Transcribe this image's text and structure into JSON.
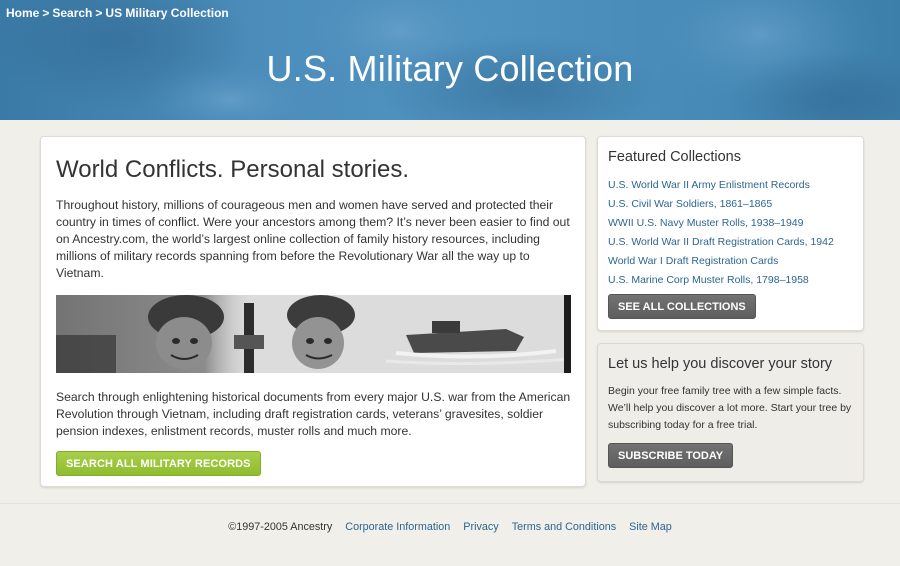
{
  "breadcrumb": {
    "home": "Home",
    "search": "Search",
    "current": "US Military Collection",
    "separator": ">"
  },
  "hero": {
    "title": "U.S. Military Collection"
  },
  "main": {
    "heading": "World Conflicts. Personal stories.",
    "intro": "Throughout history, millions of courageous men and women have served and protected their country in times of conflict. Were your ancestors among them? It’s never been easier to find out on Ancestry.com, the world’s largest online collection of family history resources, including millions of military records spanning from before the Revolutionary War all the way up to Vietnam.",
    "details": "Search through enlightening historical documents from every major U.S. war from the American Revolution through Vietnam, including draft registration cards, veterans’ gravesites, soldier pension indexes, enlistment records, muster rolls and much more.",
    "search_button": "SEARCH ALL MILITARY RECORDS"
  },
  "featured": {
    "heading": "Featured Collections",
    "items": [
      {
        "label": "U.S. World War II Army Enlistment Records"
      },
      {
        "label": "U.S. Civil War Soldiers, 1861–1865"
      },
      {
        "label": "WWII U.S. Navy Muster Rolls, 1938–1949"
      },
      {
        "label": "U.S. World War II Draft Registration Cards, 1942"
      },
      {
        "label": "World War I Draft Registration Cards"
      },
      {
        "label": "U.S. Marine Corp Muster Rolls, 1798–1958"
      }
    ],
    "see_all_button": "SEE ALL COLLECTIONS"
  },
  "help": {
    "heading": "Let us help you discover your story",
    "text": "Begin your free family tree with a few simple facts. We’ll help you discover a lot more. Start your tree by subscribing today for a free trial.",
    "subscribe_button": "SUBSCRIBE TODAY"
  },
  "footer": {
    "copyright": "©1997-2005 Ancestry",
    "links": [
      {
        "label": "Corporate Information"
      },
      {
        "label": "Privacy"
      },
      {
        "label": "Terms and Conditions"
      },
      {
        "label": "Site Map"
      }
    ]
  },
  "colors": {
    "hero_blue": "#4c8dbb",
    "link_blue": "#2d6590",
    "green_button": "#9ac63c",
    "gray_button": "#666666",
    "page_background": "#f1efea"
  }
}
